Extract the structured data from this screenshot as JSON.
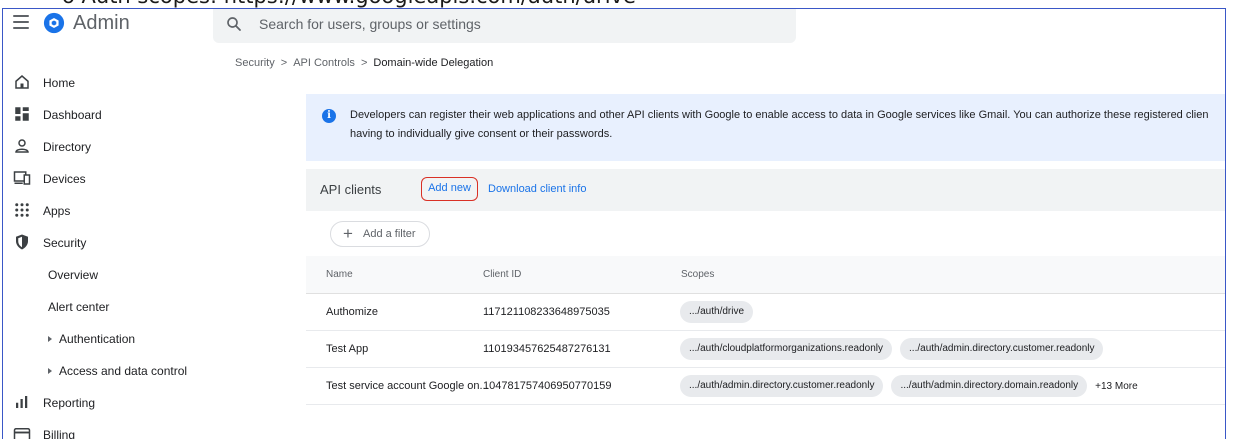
{
  "doc_header_text": "o Auth scopes: https://www.googleapis.com/auth/drive",
  "colors": {
    "accent": "#1a73e8",
    "highlight_border": "#d93025",
    "banner_bg": "#e8f0fe",
    "frame": "#3a57c7"
  },
  "app": {
    "name": "Admin",
    "logo_icon": "admin-logo-icon",
    "menu_icon": "hamburger-menu-icon"
  },
  "search": {
    "placeholder": "Search for users, groups or settings",
    "icon": "search-icon"
  },
  "sidebar": {
    "items": [
      {
        "label": "Home",
        "icon": "home-icon"
      },
      {
        "label": "Dashboard",
        "icon": "dashboard-icon"
      },
      {
        "label": "Directory",
        "icon": "person-icon"
      },
      {
        "label": "Devices",
        "icon": "devices-icon"
      },
      {
        "label": "Apps",
        "icon": "apps-grid-icon"
      },
      {
        "label": "Security",
        "icon": "shield-icon"
      },
      {
        "label": "Overview"
      },
      {
        "label": "Alert center"
      },
      {
        "label": "Authentication",
        "icon": "caret-right-icon"
      },
      {
        "label": "Access and data control",
        "icon": "caret-right-icon"
      },
      {
        "label": "Reporting",
        "icon": "bar-chart-icon"
      },
      {
        "label": "Billing",
        "icon": "billing-icon"
      }
    ]
  },
  "breadcrumb": {
    "items": [
      "Security",
      "API Controls"
    ],
    "current": "Domain-wide Delegation",
    "separator": ">"
  },
  "banner": {
    "icon": "info-icon",
    "line1": "Developers can register their web applications and other API clients with Google to enable access to data in Google services like Gmail. You can authorize these registered clien",
    "line2": "having to individually give consent or their passwords."
  },
  "api_clients": {
    "title": "API clients",
    "add_new_label": "Add new",
    "download_label": "Download client info",
    "filter_label": "Add a filter",
    "columns": {
      "name": "Name",
      "client_id": "Client ID",
      "scopes": "Scopes"
    },
    "rows": [
      {
        "name": "Authomize",
        "client_id": "117121108233648975035",
        "scopes": [
          ".../auth/drive"
        ],
        "more": ""
      },
      {
        "name": "Test App",
        "client_id": "110193457625487276131",
        "scopes": [
          ".../auth/cloudplatformorganizations.readonly",
          ".../auth/admin.directory.customer.readonly"
        ],
        "more": ""
      },
      {
        "name": "Test service account Google on...",
        "client_id": "104781757406950770159",
        "scopes": [
          ".../auth/admin.directory.customer.readonly",
          ".../auth/admin.directory.domain.readonly"
        ],
        "more": "+13 More"
      }
    ]
  }
}
